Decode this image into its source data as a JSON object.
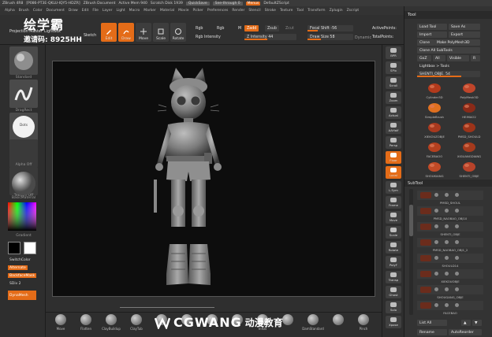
{
  "titlebar": {
    "app": "ZBrush 4R8",
    "info": "[P086-PT3E-QKLU-IQY5-HDZR]",
    "doc": "ZBrush Document",
    "mem": "Active Mem 940",
    "scratch": "Scratch Disk 1939",
    "quicksave": "QuickSave",
    "seethrough": "See-through 0",
    "menus": "Menus",
    "script": "DefaultZScript"
  },
  "menu": [
    "Alpha",
    "Brush",
    "Color",
    "Document",
    "Draw",
    "Edit",
    "File",
    "Layer",
    "Light",
    "Macro",
    "Marker",
    "Material",
    "Movie",
    "Picker",
    "Preferences",
    "Render",
    "Stencil",
    "Stroke",
    "Texture",
    "Tool",
    "Transform",
    "Zplugin",
    "Zscript"
  ],
  "toolbar": {
    "projection_master": "Projection Master",
    "lightbox": "LightBox",
    "sketch": "Sketch",
    "edit": "Edit",
    "draw": "Draw",
    "move": "Move",
    "scale": "Scale",
    "rotate": "Rotate",
    "rgb": "Rgb",
    "rgb2": "Rgb",
    "m": "M",
    "rgb_intensity": "Rgb Intensity",
    "zadd": "Zadd",
    "zsub": "Zsub",
    "zcut": "Zcut",
    "z_intensity": "Z Intensity 44",
    "focal_shift": "Focal Shift -56",
    "draw_size": "Draw Size 58",
    "dynamic": "Dynamic",
    "active_points": "ActivePoints:",
    "total_points": "TotalPoints:"
  },
  "leftshelf": {
    "tiles": [
      "Standard",
      "DragRect",
      "Dots",
      "Alpha Off",
      "Texture Off",
      "BasicMaterial"
    ],
    "gradient": "Gradient",
    "switch_color": "SwitchColor",
    "alternate": "Alternate",
    "backfacemask": "BackfaceMask",
    "sdiv": "SDiv 2",
    "dynamesh": "DynaMesh"
  },
  "rightshelf": [
    "BPR",
    "SPix",
    "Scroll",
    "Zoom",
    "Actual",
    "AAHalf",
    "Persp",
    "Floor",
    "Local",
    "L.Sym",
    "Frame",
    "Move",
    "Scale",
    "Rotate",
    "PolyF",
    "Transp",
    "Ghost",
    "Solo",
    "Xpose"
  ],
  "toolpanel": {
    "title": "Tool",
    "load_tool": "Load Tool",
    "save_as": "Save As",
    "import": "Import",
    "export": "Export",
    "clone": "Clone",
    "make_polymesh": "Make PolyMesh3D",
    "clone_all": "Clone All SubTools",
    "goz": "GoZ",
    "all": "All",
    "visible": "Visible",
    "r": "R",
    "lightbox_tools": "Lightbox > Tools",
    "current_tool": "SHENTI_OBJE. 54",
    "thumbs": [
      "Cylinder3D",
      "PolyMesh3D",
      "SimpleBrush",
      "HEIMAO2",
      "XIEKOUZOBJE",
      "PMSD_SHOULD",
      "FACEBAOO",
      "XIGUANGDIANG",
      "SHOUKIANG",
      "SHENTI_OBJE"
    ],
    "subtool": "SubTool",
    "subtools": [
      "PMSD_SHOUL",
      "PMSD_NAOBAO_OBJ10",
      "SHENTI_OBJE",
      "PMSD_NAOBAO_OBJ1_2",
      "SHOULD14",
      "XIEKOUOBJE",
      "SHOUGANG_OBJE",
      "FACEBAO"
    ],
    "list_all": "List All",
    "rename": "Rename",
    "autoreorder": "AutoReorder"
  },
  "bottombar": [
    "Move",
    "Flatten",
    "ClayBuildup",
    "ClayTub",
    "",
    "",
    "",
    "",
    "Inflat",
    "",
    "DamStandard",
    "",
    "Pinch"
  ],
  "watermark": {
    "brand": "绘学霸",
    "code": "邀请码: 8925HH",
    "logo": "CGWANG",
    "logo_cn": "动漫教育"
  }
}
